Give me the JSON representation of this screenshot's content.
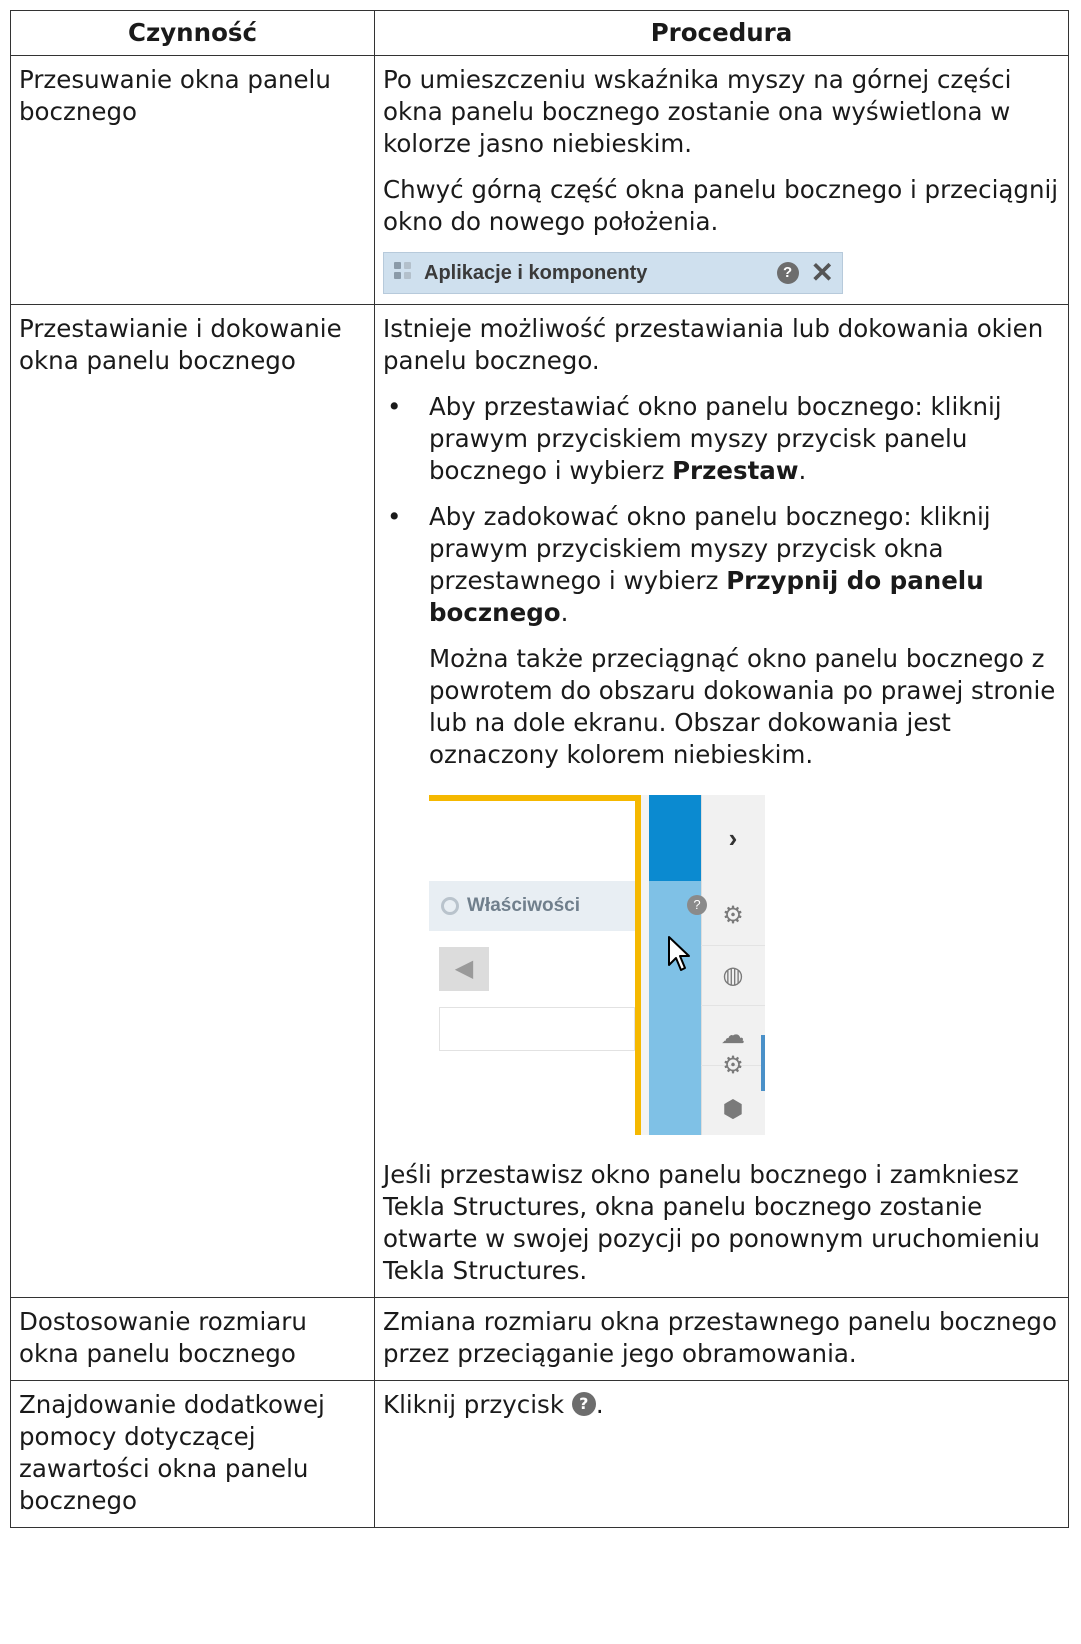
{
  "headers": {
    "col1": "Czynność",
    "col2": "Procedura"
  },
  "rows": [
    {
      "action": "Przesuwanie okna panelu bocznego",
      "p1": "Po umieszczeniu wskaźnika myszy na górnej części okna panelu bocznego zostanie ona wyświetlona w kolorze jasno niebieskim.",
      "p2": "Chwyć górną część okna panelu bocznego i przeciągnij okno do nowego położenia.",
      "titlebar_label": "Aplikacje i komponenty",
      "help_glyph": "?",
      "close_glyph": "✕"
    },
    {
      "action": "Przestawianie i dokowanie okna panelu bocznego",
      "p1": "Istnieje możliwość przestawiania lub dokowania okien panelu bocznego.",
      "bullet1_pre": "Aby przestawiać okno panelu bocznego: kliknij prawym przyciskiem myszy przycisk panelu bocznego i wybierz ",
      "bullet1_bold": "Przestaw",
      "bullet1_post": ".",
      "bullet2_pre": "Aby zadokować okno panelu bocznego: kliknij prawym przyciskiem myszy przycisk okna przestawnego i wybierz ",
      "bullet2_bold": "Przypnij do panelu bocznego",
      "bullet2_post": ".",
      "note": "Można także przeciągnąć okno panelu bocznego z powrotem do obszaru dokowania po prawej stronie lub na dole ekranu. Obszar dokowania jest oznaczony kolorem niebieskim.",
      "shot_panel_title": "Właściwości",
      "p_last": "Jeśli przestawisz okno panelu bocznego i zamkniesz Tekla Structures, okna panelu bocznego zostanie otwarte w swojej pozycji po ponownym uruchomieniu Tekla Structures."
    },
    {
      "action": "Dostosowanie rozmiaru okna panelu bocznego",
      "p1": "Zmiana rozmiaru okna przestawnego panelu bocznego przez przeciąganie jego obramowania."
    },
    {
      "action": "Znajdowanie dodatkowej pomocy dotyczącej zawartości okna panelu bocznego",
      "p1": "Kliknij przycisk",
      "p1_post": "."
    }
  ],
  "bullet_glyph": "•",
  "colors": {
    "dock_blue": "#0b8ad0",
    "dock_light_blue": "#7fc1e6",
    "titlebar_blue": "#cfe0ee",
    "yellow_border": "#f5b800"
  }
}
